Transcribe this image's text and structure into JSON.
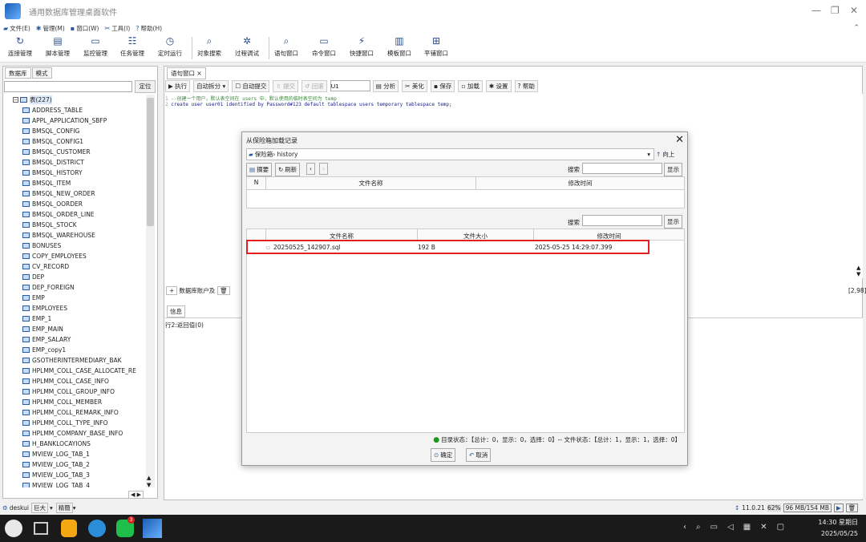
{
  "window": {
    "title": "通用数据库管理桌面软件"
  },
  "menu": [
    {
      "icon": "folder-icon",
      "label": "文件(E)"
    },
    {
      "icon": "gear-icon",
      "label": "管理(M)"
    },
    {
      "icon": "window-icon",
      "label": "窗口(W)"
    },
    {
      "icon": "tools-icon",
      "label": "工具(I)"
    },
    {
      "icon": "help-icon",
      "label": "帮助(H)"
    }
  ],
  "toolbar": [
    {
      "label": "连接管理",
      "icon": "↻"
    },
    {
      "label": "脚本管理",
      "icon": "▤"
    },
    {
      "label": "监控管理",
      "icon": "▭"
    },
    {
      "label": "任务管理",
      "icon": "☷"
    },
    {
      "label": "定时运行",
      "icon": "◷"
    },
    {
      "label": "对象搜索",
      "icon": "⌕"
    },
    {
      "label": "过程调试",
      "icon": "✲"
    },
    {
      "label": "语句窗口",
      "icon": "⌕"
    },
    {
      "label": "命令窗口",
      "icon": "▭"
    },
    {
      "label": "快捷窗口",
      "icon": "⚡"
    },
    {
      "label": "模板窗口",
      "icon": "▥"
    },
    {
      "label": "平铺窗口",
      "icon": "⊞"
    }
  ],
  "left": {
    "tabs": [
      "数据库",
      "模式"
    ],
    "locate": "定位",
    "root": "表(227)",
    "tables": [
      "ADDRESS_TABLE",
      "APPL_APPLICATION_SBFP",
      "BMSQL_CONFIG",
      "BMSQL_CONFIG1",
      "BMSQL_CUSTOMER",
      "BMSQL_DISTRICT",
      "BMSQL_HISTORY",
      "BMSQL_ITEM",
      "BMSQL_NEW_ORDER",
      "BMSQL_OORDER",
      "BMSQL_ORDER_LINE",
      "BMSQL_STOCK",
      "BMSQL_WAREHOUSE",
      "BONUSES",
      "COPY_EMPLOYEES",
      "CV_RECORD",
      "DEP",
      "DEP_FOREIGN",
      "EMP",
      "EMPLOYEES",
      "EMP_1",
      "EMP_MAIN",
      "EMP_SALARY",
      "EMP_copy1",
      "GSOTHERINTERMEDIARY_BAK",
      "HPLMM_COLL_CASE_ALLOCATE_RE",
      "HPLMM_COLL_CASE_INFO",
      "HPLMM_COLL_GROUP_INFO",
      "HPLMM_COLL_MEMBER",
      "HPLMM_COLL_REMARK_INFO",
      "HPLMM_COLL_TYPE_INFO",
      "HPLMM_COMPANY_BASE_INFO",
      "H_BANKLOCAYIONS",
      "MVIEW_LOG_TAB_1",
      "MVIEW_LOG_TAB_2",
      "MVIEW_LOG_TAB_3",
      "MVIEW_LOG_TAB_4"
    ],
    "bottom": {
      "user": "deskui",
      "size": "巨大",
      "mode": "精簡"
    }
  },
  "editor": {
    "tab": "语句窗口",
    "buttons": [
      "执行",
      "自动拆分",
      "自动提交",
      "提交",
      "回滚"
    ],
    "schema_value": "U1",
    "buttons2": [
      "分析",
      "美化",
      "保存",
      "加载",
      "设置",
      "帮助"
    ],
    "code1": "--创建一个用户，默认表空间在 users 中，默认使用的临时表空间为 temp",
    "code2": "create user user01 identified by Password#123 default tablespace users temporary tablespace temp;",
    "cursor": "[2,98]",
    "bottom_tab": "数据库账户及",
    "info_tab": "信息",
    "info_text": "行2:返回值(0)"
  },
  "dialog": {
    "title": "从保险箱加载记录",
    "path": "保险箱› history",
    "up": "向上",
    "summary_btn": "摘要",
    "refresh_btn": "刷新",
    "search_label": "搜索",
    "show_btn": "显示",
    "grid1_cols": [
      "N",
      "文件名称",
      "修改时间"
    ],
    "grid2_cols": [
      "文件名称",
      "文件大小",
      "修改时间"
    ],
    "file": {
      "name": "20250525_142907.sql",
      "size": "192 B",
      "mtime": "2025-05-25 14:29:07.399"
    },
    "status": "目录状态：【总计：0，显示：0，选择：0】-- 文件状态：【总计：1，显示：1，选择：0】",
    "ok": "确定",
    "cancel": "取消"
  },
  "status": {
    "version": "11.0.21",
    "pct": "62%",
    "mem": "96 MB/154 MB"
  },
  "taskbar": {
    "time": "14:30 星期日",
    "date": "2025/05/25",
    "badge": "3"
  }
}
